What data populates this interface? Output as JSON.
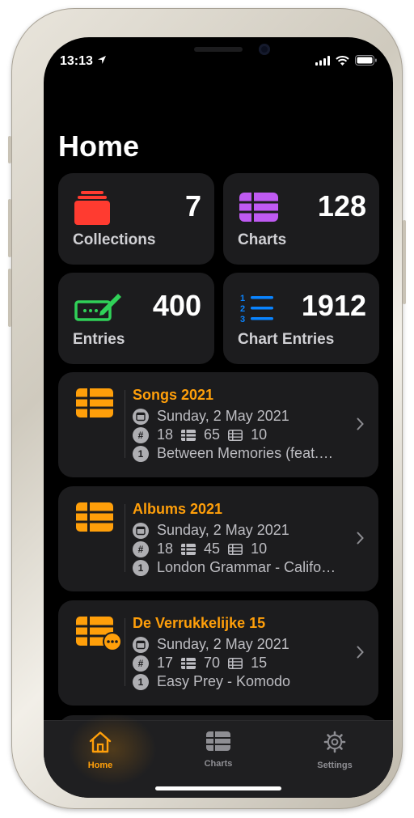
{
  "status_bar": {
    "time": "13:13"
  },
  "page": {
    "title": "Home"
  },
  "stats": [
    {
      "label": "Collections",
      "value": "7",
      "icon": "collections-stack-icon",
      "color": "#ff3b30"
    },
    {
      "label": "Charts",
      "value": "128",
      "icon": "chart-grid-icon",
      "color": "#bf5af2"
    },
    {
      "label": "Entries",
      "value": "400",
      "icon": "ticket-pencil-icon",
      "color": "#30d158"
    },
    {
      "label": "Chart Entries",
      "value": "1912",
      "icon": "numbered-list-icon",
      "color": "#0a84ff"
    }
  ],
  "charts": [
    {
      "title": "Songs 2021",
      "date": "Sunday, 2 May 2021",
      "number": "18",
      "entries": "65",
      "new_entries": "10",
      "top_entry": "Between Memories (feat.…",
      "icon": "chart-grid-icon"
    },
    {
      "title": "Albums 2021",
      "date": "Sunday, 2 May 2021",
      "number": "18",
      "entries": "45",
      "new_entries": "10",
      "top_entry": "London Grammar - Califo…",
      "icon": "chart-grid-icon"
    },
    {
      "title": "De Verrukkelijke 15",
      "date": "Sunday, 2 May 2021",
      "number": "17",
      "entries": "70",
      "new_entries": "15",
      "top_entry": "Easy Prey - Komodo",
      "icon": "chart-grid-more-icon"
    }
  ],
  "row_icons": {
    "hash": "#",
    "position": "1"
  },
  "tab_bar": {
    "tabs": [
      {
        "label": "Home",
        "icon": "house-icon",
        "active": true
      },
      {
        "label": "Charts",
        "icon": "chart-grid-icon",
        "active": false
      },
      {
        "label": "Settings",
        "icon": "gear-icon",
        "active": false
      }
    ]
  },
  "colors": {
    "accent": "#ff9f0a",
    "background": "#000000",
    "card": "#1c1c1e",
    "inactive_tab": "#8e8e93"
  }
}
